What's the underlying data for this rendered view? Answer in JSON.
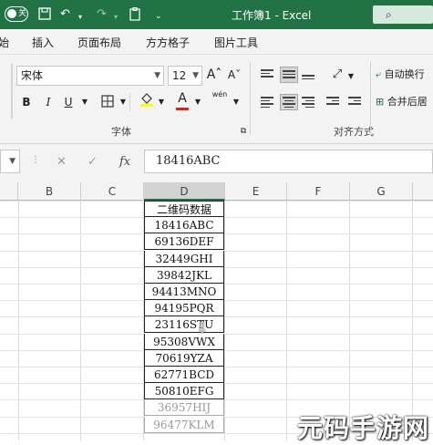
{
  "titlebar": {
    "autosave_label": "关",
    "title": "工作簿1 - Excel",
    "search_icon": "search-icon",
    "colors": {
      "accent": "#217346"
    }
  },
  "tabs": [
    "始",
    "插入",
    "页面布局",
    "方方格子",
    "图片工具"
  ],
  "ribbon": {
    "font_name": "宋体",
    "font_size": "12",
    "grow_font": "Aˆ",
    "shrink_font": "Aˇ",
    "wen": "wén",
    "bold": "B",
    "italic": "I",
    "underline": "U",
    "group_font": "字体",
    "group_align": "对齐方式",
    "wrap_text": "自动换行",
    "merge_center": "合并后居"
  },
  "formula_bar": {
    "cancel": "✕",
    "enter": "✓",
    "fx": "fx",
    "value": "18416ABC"
  },
  "grid": {
    "columns": [
      "B",
      "C",
      "D",
      "E",
      "F",
      "G"
    ],
    "active_column": "D",
    "cells": [
      {
        "text": "二维码数据"
      },
      {
        "text": "18416ABC"
      },
      {
        "text": "69136DEF"
      },
      {
        "text": "32449GHI"
      },
      {
        "text": "39842JKL"
      },
      {
        "text": "94413MNO"
      },
      {
        "text": "94195PQR"
      },
      {
        "text": "23116STU"
      },
      {
        "text": "95308VWX"
      },
      {
        "text": "70619YZA"
      },
      {
        "text": "62771BCD"
      },
      {
        "text": "50810EFG"
      },
      {
        "text": "36957HIJ"
      },
      {
        "text": "96477KLM"
      }
    ]
  },
  "watermark": "元码手游网"
}
